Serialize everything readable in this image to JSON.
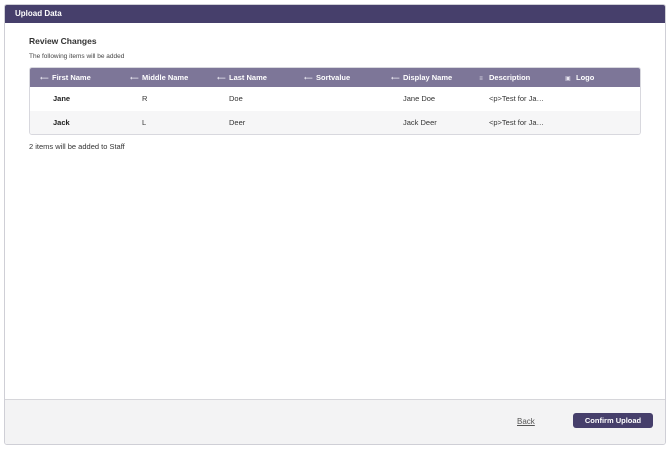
{
  "dialog": {
    "title": "Upload Data"
  },
  "review": {
    "title": "Review Changes",
    "subtitle": "The following items will be added"
  },
  "table": {
    "columns": [
      {
        "label": "First Name",
        "icon": "text-field-icon"
      },
      {
        "label": "Middle Name",
        "icon": "text-field-icon"
      },
      {
        "label": "Last Name",
        "icon": "text-field-icon"
      },
      {
        "label": "Sortvalue",
        "icon": "text-field-icon"
      },
      {
        "label": "Display Name",
        "icon": "text-field-icon"
      },
      {
        "label": "Description",
        "icon": "rich-text-icon"
      },
      {
        "label": "Logo",
        "icon": "image-icon"
      }
    ],
    "rows": [
      {
        "first": "Jane",
        "middle": "R",
        "last": "Doe",
        "sort": "",
        "display": "Jane Doe",
        "description": "<p>Test for Ja…",
        "logo": ""
      },
      {
        "first": "Jack",
        "middle": "L",
        "last": "Deer",
        "sort": "",
        "display": "Jack Deer",
        "description": "<p>Test for Ja…",
        "logo": ""
      }
    ]
  },
  "summary": "2 items will be added to Staff",
  "footer": {
    "back_label": "Back",
    "confirm_label": "Confirm Upload"
  },
  "colors": {
    "header_bar": "#463f6b",
    "table_header": "#7d7698",
    "primary_button": "#463f6b"
  }
}
